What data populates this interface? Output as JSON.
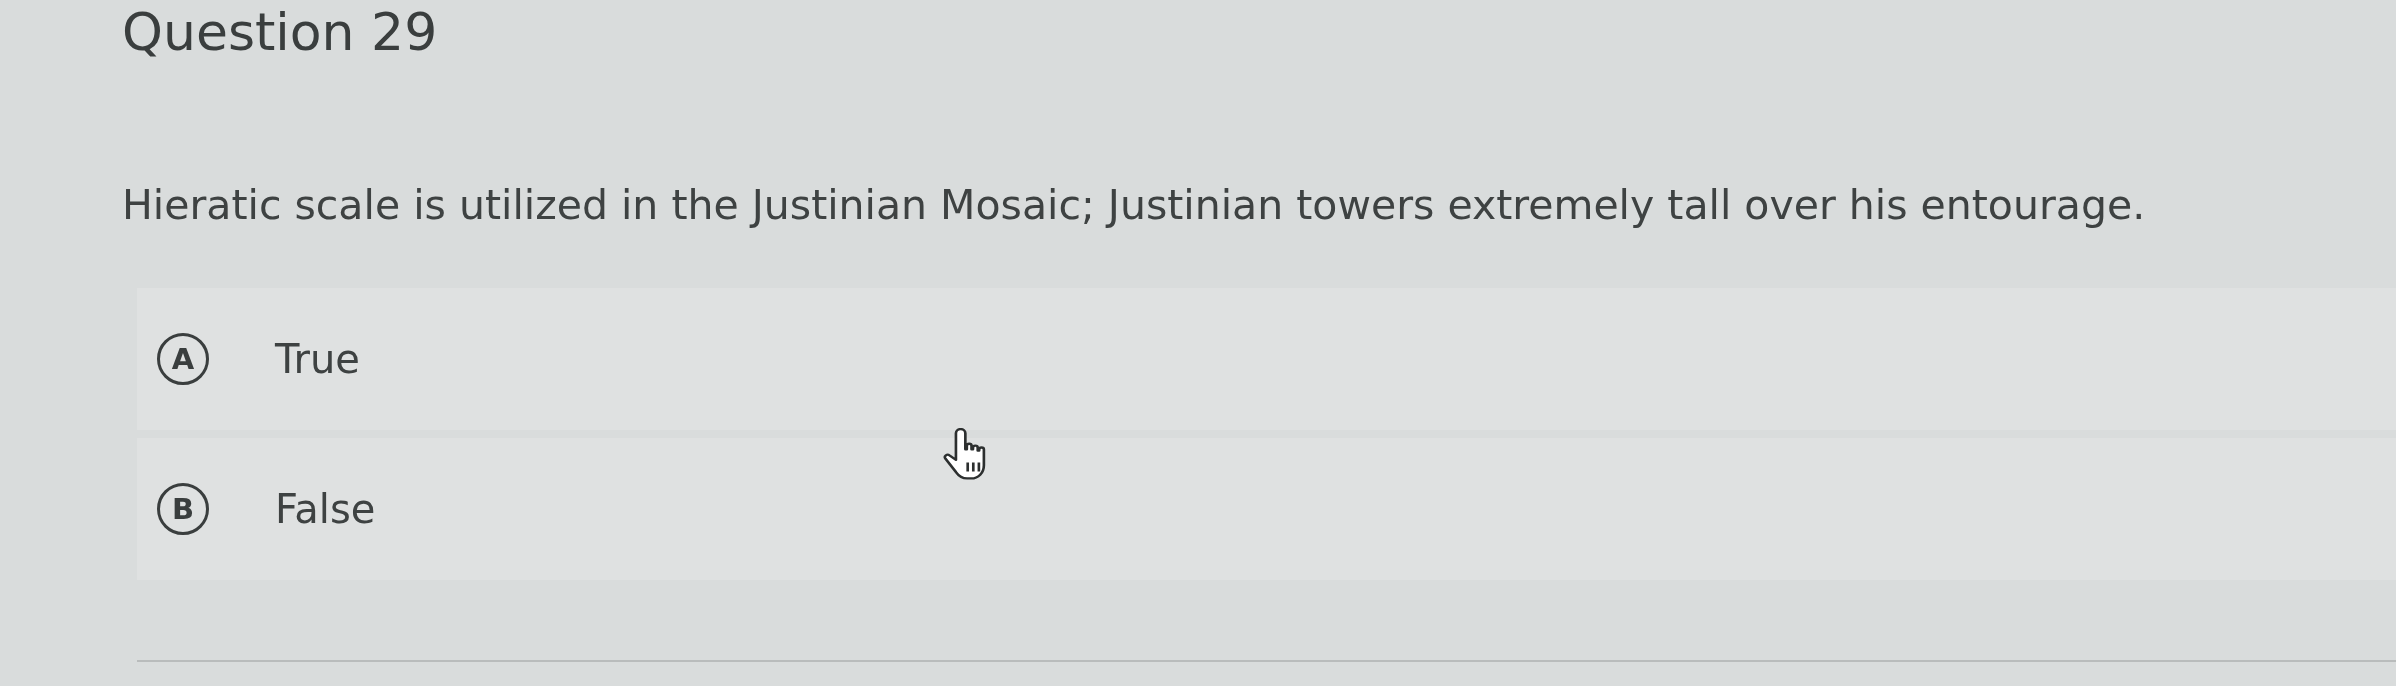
{
  "question": {
    "title": "Question 29",
    "prompt": "Hieratic scale is utilized in the Justinian Mosaic; Justinian towers extremely tall over his entourage.",
    "options": [
      {
        "letter": "A",
        "label": "True",
        "selected": false
      },
      {
        "letter": "B",
        "label": "False",
        "selected": false
      }
    ]
  }
}
